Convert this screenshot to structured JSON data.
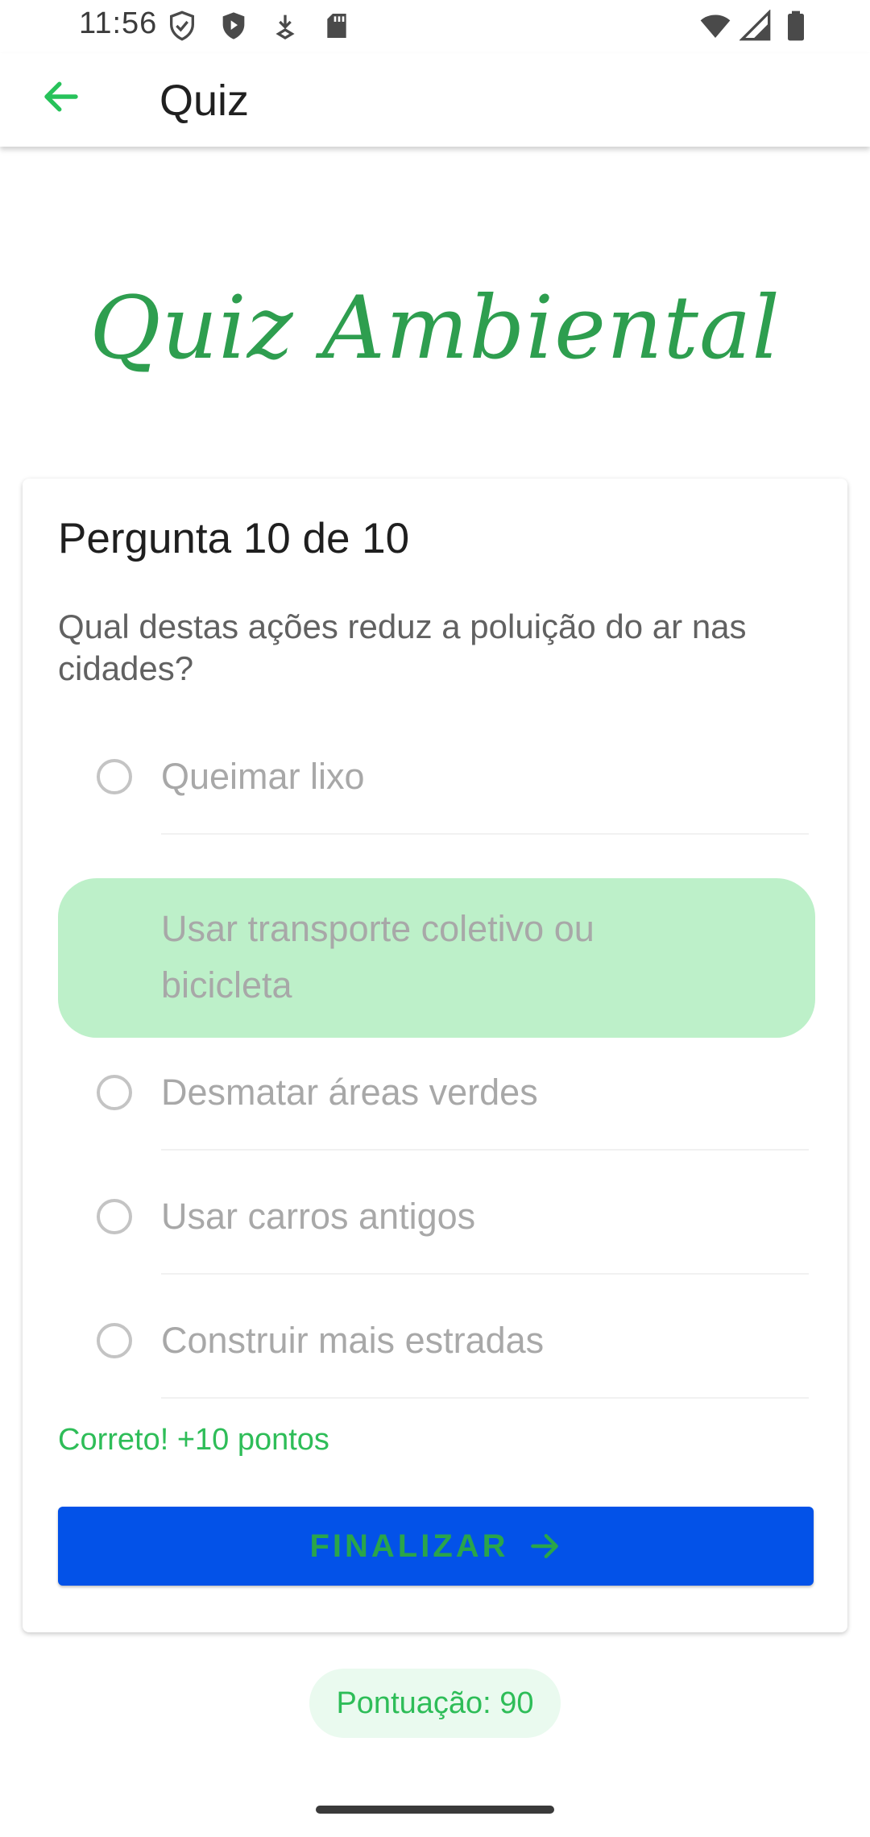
{
  "status_bar": {
    "time": "11:56",
    "left_icons": [
      "vpn-shield-outline-icon",
      "shield-play-icon",
      "download-arrow-icon",
      "sd-card-icon"
    ],
    "right_icons": [
      "wifi-icon",
      "cellular-signal-icon",
      "battery-icon"
    ]
  },
  "app_bar": {
    "title": "Quiz",
    "back_icon": "arrow-back-icon"
  },
  "logo": {
    "text": "Quiz Ambiental"
  },
  "card": {
    "counter": "Pergunta 10 de 10",
    "question": "Qual destas ações reduz a poluição do ar nas cidades?",
    "options": [
      {
        "label": "Queimar lixo",
        "selected": false
      },
      {
        "label": "Usar transporte coletivo ou bicicleta",
        "selected": true
      },
      {
        "label": "Desmatar áreas verdes",
        "selected": false
      },
      {
        "label": "Usar carros antigos",
        "selected": false
      },
      {
        "label": "Construir mais estradas",
        "selected": false
      }
    ],
    "feedback": "Correto! +10 pontos",
    "finish_label": "FINALIZAR",
    "finish_icon": "arrow-forward-icon"
  },
  "score": {
    "label": "Pontuação: 90"
  },
  "colors": {
    "accent_green": "#2ebd58",
    "logo_green": "#2e9e4f",
    "selected_bg": "#bdf0c9",
    "button_blue": "#0352e8"
  }
}
